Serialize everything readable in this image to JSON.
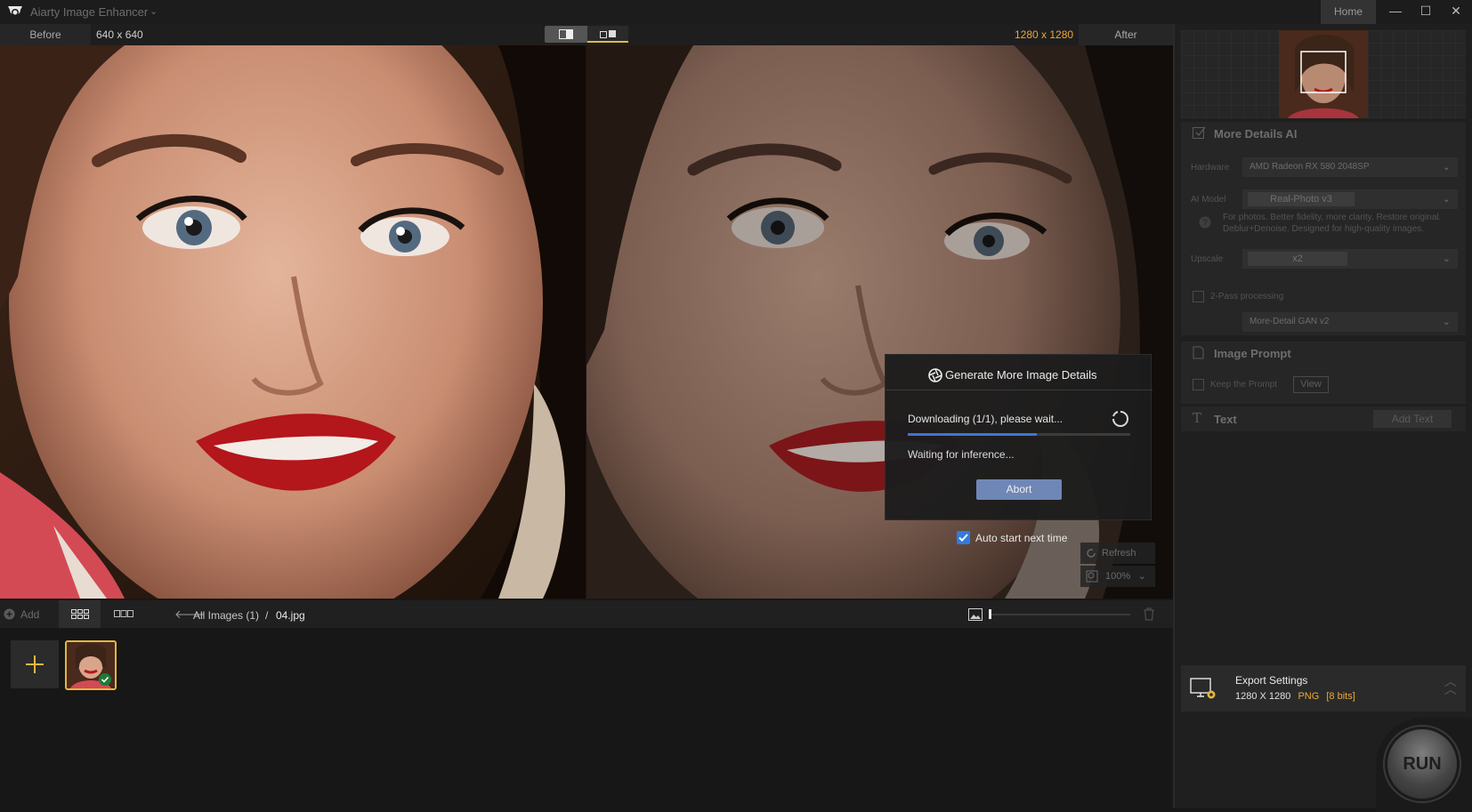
{
  "titlebar": {
    "app_title": "Aiarty Image Enhancer",
    "home_label": "Home",
    "minimize_glyph": "—",
    "maximize_glyph": "☐",
    "close_glyph": "✕"
  },
  "compare": {
    "before_label": "Before",
    "before_size": "640 x 640",
    "after_size": "1280 x 1280",
    "after_label": "After"
  },
  "dialog": {
    "title": "Generate More Image Details",
    "status": "Downloading (1/1), please wait...",
    "progress": 0.58,
    "waiting": "Waiting for inference...",
    "abort_label": "Abort"
  },
  "auto_start": {
    "label": "Auto start next time",
    "checked": true
  },
  "image_tools": {
    "refresh_label": "Refresh",
    "zoom_label": "100%"
  },
  "bottom_bar": {
    "add_label": "Add",
    "crumb_all": "All Images (1)",
    "crumb_sep": "/",
    "crumb_file": "04.jpg"
  },
  "panel": {
    "details": {
      "title": "More Details AI",
      "hardware_label": "Hardware",
      "hardware_value": "AMD Radeon RX 580 2048SP",
      "model_label": "AI Model",
      "model_value": "Real-Photo v3",
      "model_desc_1": "For photos. Better fidelity, more clarity. Restore original.",
      "model_desc_2": "Deblur+Denoise. Designed for high-quality images.",
      "upscale_label": "Upscale",
      "upscale_value": "x2",
      "twopass_label": "2-Pass processing",
      "twopass_value": "More-Detail GAN v2"
    },
    "prompt": {
      "title": "Image Prompt",
      "keep_label": "Keep the Prompt",
      "view_label": "View"
    },
    "text": {
      "title": "Text",
      "add_label": "Add Text"
    },
    "export": {
      "title": "Export Settings",
      "size": "1280 X 1280",
      "format": "PNG",
      "bits": "[8 bits]"
    },
    "run_label": "RUN"
  },
  "colors": {
    "accent_gold": "#e4b73e",
    "size_orange": "#e9a93a",
    "progress_blue": "#3b76d6",
    "abort_blue": "#6f87b6",
    "checkbox_blue": "#2f7be0"
  },
  "icons": [
    "app-logo-icon",
    "chevron-down-icon",
    "side-by-side-view-icon",
    "split-view-icon",
    "aperture-icon",
    "spinner-icon",
    "checkmark-icon",
    "refresh-icon",
    "zoom-icon",
    "add-circle-icon",
    "grid-view-icon",
    "strip-view-icon",
    "back-arrow-icon",
    "image-icon",
    "trash-icon",
    "plus-icon",
    "edit-checkbox-icon",
    "help-icon",
    "document-icon",
    "text-t-icon",
    "export-monitor-icon",
    "double-chevron-up-icon"
  ]
}
